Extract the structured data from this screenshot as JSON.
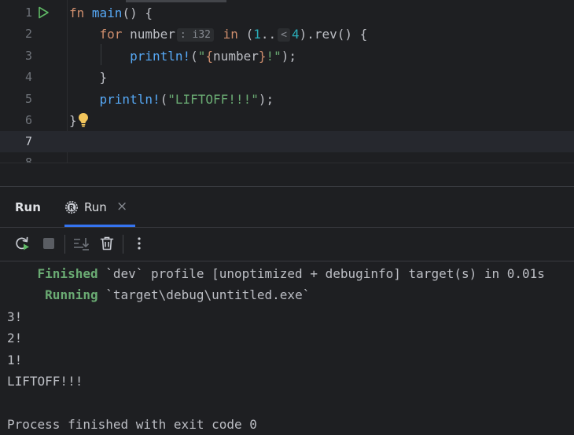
{
  "editor": {
    "line_numbers": [
      "1",
      "2",
      "3",
      "4",
      "5",
      "6",
      "7"
    ],
    "line8_partial": "8",
    "code": {
      "l1_kw": "fn",
      "l1_name": "main",
      "l1_rest": "() {",
      "l2_kw": "for",
      "l2_var": "number",
      "l2_type_hint": ": i32",
      "l2_in": "in",
      "l2_open": "(",
      "l2_start": "1",
      "l2_dots": "..",
      "l2_range_hint": "<",
      "l2_end": "4",
      "l2_rest": ").rev() {",
      "l3_macro": "println!",
      "l3_open": "(",
      "l3_str_a": "\"",
      "l3_interp_open": "{",
      "l3_interp_var": "number",
      "l3_interp_close": "}",
      "l3_str_b": "!\"",
      "l3_close": ");",
      "l4": "}",
      "l5_macro": "println!",
      "l5_open": "(",
      "l5_str": "\"LIFTOFF!!!\"",
      "l5_close": ");",
      "l6": "}"
    },
    "icons": {
      "run_gutter": "run-gutter-icon",
      "bulb": "lightbulb-icon"
    }
  },
  "panel": {
    "title": "Run",
    "tab_label": "Run",
    "tab_close": "×",
    "accent": "#3574f0"
  },
  "console": {
    "finished_word": "Finished",
    "finished_rest": " `dev` profile [unoptimized + debuginfo] target(s) in 0.01s",
    "running_word": "Running",
    "running_rest": " `target\\debug\\untitled.exe`",
    "out1": "3!",
    "out2": "2!",
    "out3": "1!",
    "out4": "LIFTOFF!!!",
    "exit": "Process finished with exit code 0"
  }
}
